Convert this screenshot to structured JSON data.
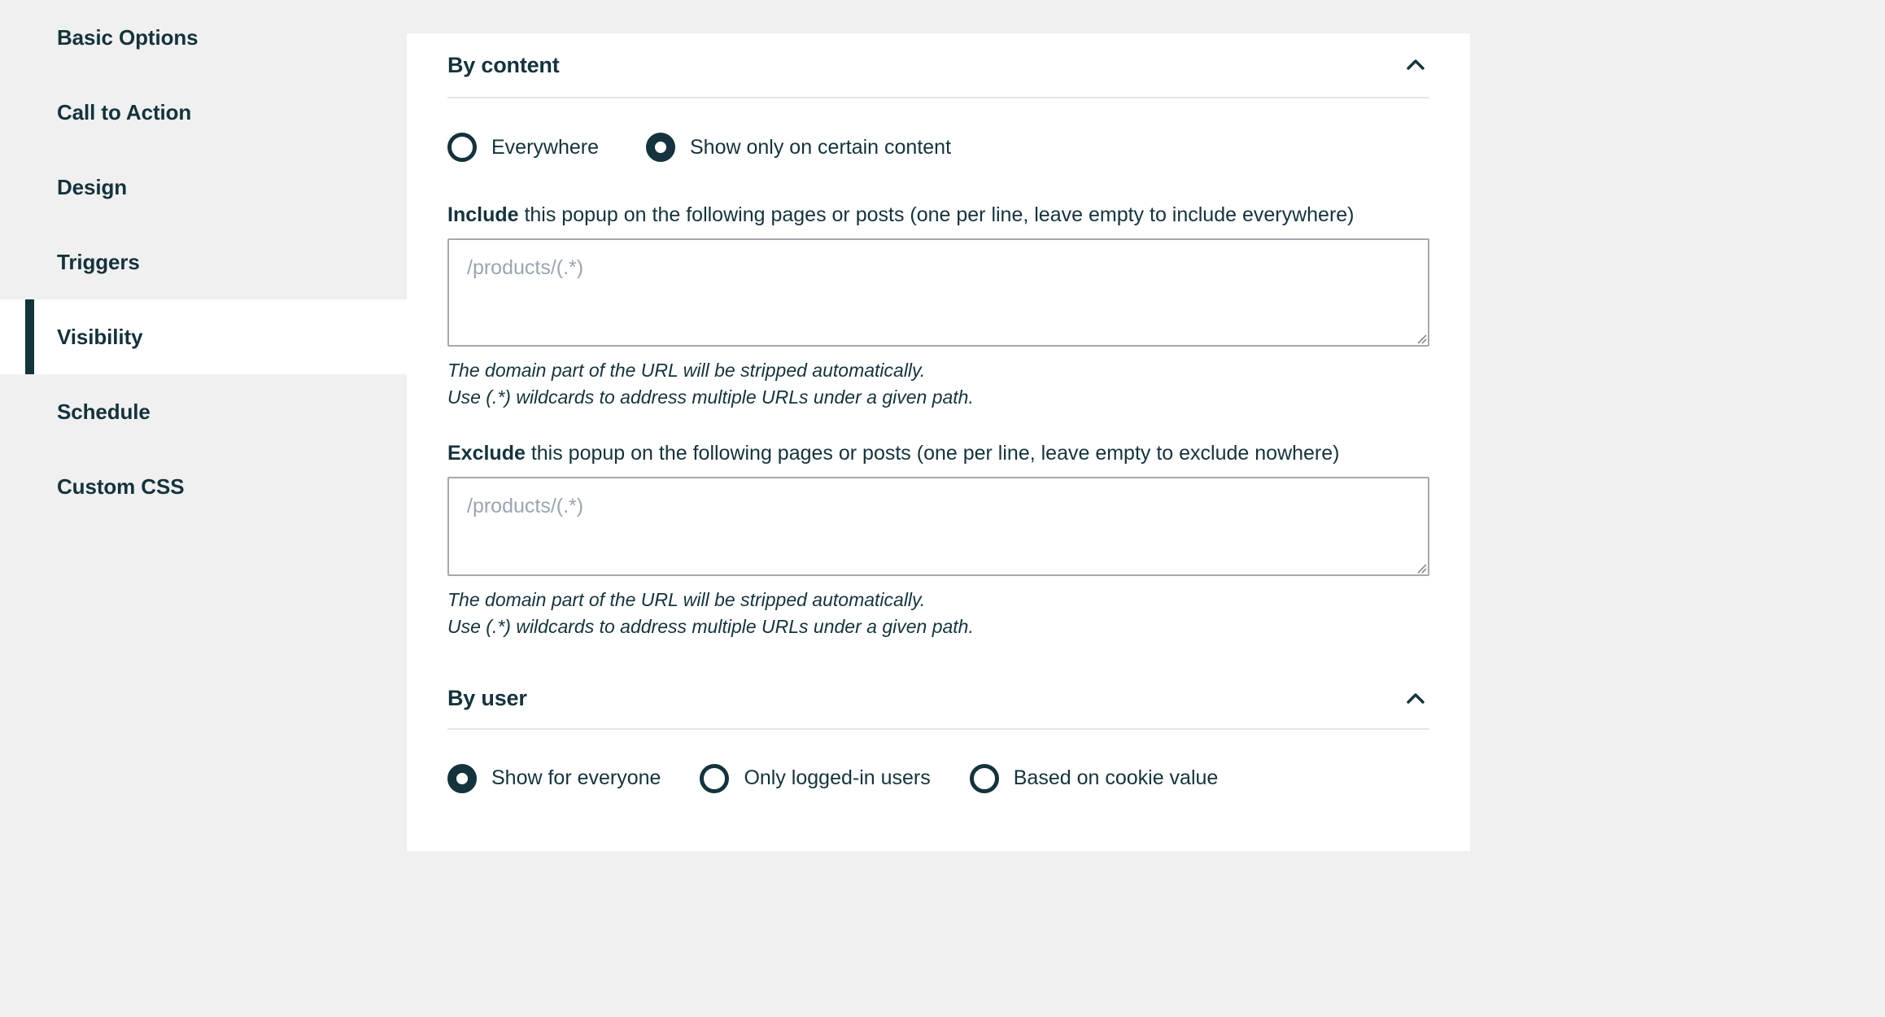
{
  "theme": {
    "page_bg": "#f0f0f0",
    "card_bg": "#ffffff",
    "accent": "#14333c",
    "divider": "#e4e6e7",
    "field_border": "#a5a9ad",
    "placeholder": "#9aa5b1"
  },
  "sidebar": {
    "items": [
      {
        "label": "Basic Options",
        "active": false
      },
      {
        "label": "Call to Action",
        "active": false
      },
      {
        "label": "Design",
        "active": false
      },
      {
        "label": "Triggers",
        "active": false
      },
      {
        "label": "Visibility",
        "active": true
      },
      {
        "label": "Schedule",
        "active": false
      },
      {
        "label": "Custom CSS",
        "active": false
      }
    ]
  },
  "by_content": {
    "title": "By content",
    "collapse_icon": "chevron-up-icon",
    "mode_options": [
      {
        "label": "Everywhere",
        "selected": false
      },
      {
        "label": "Show only on certain content",
        "selected": true
      }
    ],
    "include": {
      "label_strong": "Include",
      "label_rest": " this popup on the following pages or posts (one per line, leave empty to include everywhere)",
      "value": "",
      "placeholder": "/products/(.*)",
      "help_line_1": "The domain part of the URL will be stripped automatically.",
      "help_line_2": "Use (.*) wildcards to address multiple URLs under a given path."
    },
    "exclude": {
      "label_strong": "Exclude",
      "label_rest": " this popup on the following pages or posts (one per line, leave empty to exclude nowhere)",
      "value": "",
      "placeholder": "/products/(.*)",
      "help_line_1": "The domain part of the URL will be stripped automatically.",
      "help_line_2": "Use (.*) wildcards to address multiple URLs under a given path."
    }
  },
  "by_user": {
    "title": "By user",
    "collapse_icon": "chevron-up-icon",
    "options": [
      {
        "label": "Show for everyone",
        "selected": true
      },
      {
        "label": "Only logged-in users",
        "selected": false
      },
      {
        "label": "Based on cookie value",
        "selected": false
      }
    ]
  }
}
